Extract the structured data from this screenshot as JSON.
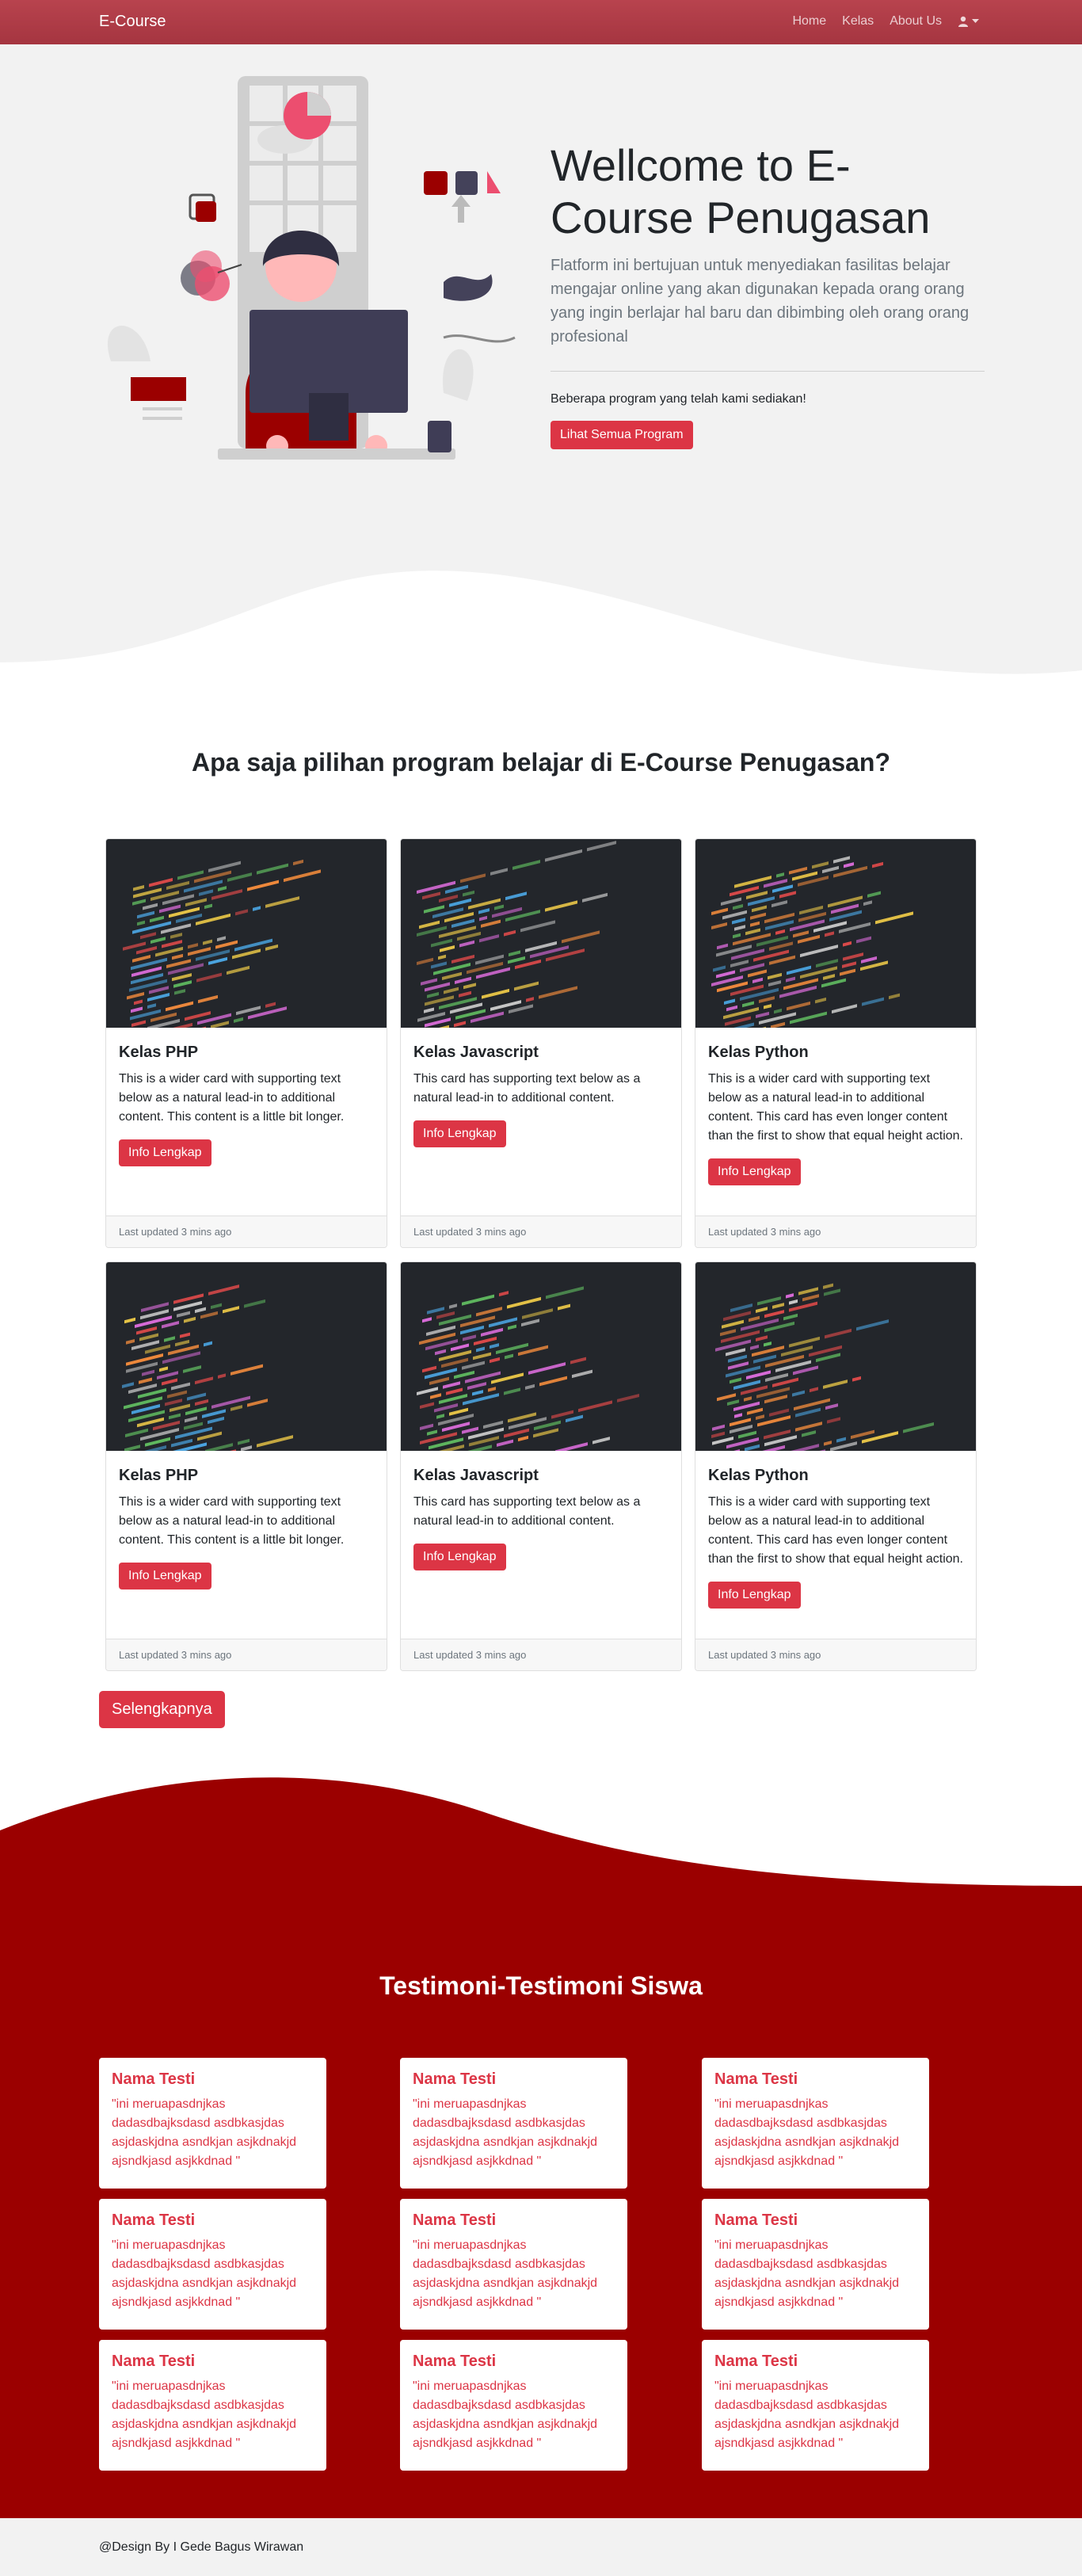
{
  "colors": {
    "brand_red": "#a53540",
    "accent_red": "#dc3545",
    "dark_red": "#9b0000",
    "hero_bg": "#f2f2f2"
  },
  "navbar": {
    "brand": "E-Course",
    "links": [
      "Home",
      "Kelas",
      "About Us"
    ],
    "user_icon": "user-icon"
  },
  "hero": {
    "title": "Wellcome to E-Course Penugasan",
    "lead": "Flatform ini bertujuan untuk menyediakan fasilitas belajar mengajar online yang akan digunakan kepada orang orang yang ingin berlajar hal baru dan dibimbing oleh orang orang profesional",
    "sub": "Beberapa program yang telah kami sediakan!",
    "button": "Lihat Semua Program"
  },
  "programs": {
    "title": "Apa saja pilihan program belajar di E-Course Penugasan?",
    "cards": [
      {
        "title": "Kelas PHP",
        "text": "This is a wider card with supporting text below as a natural lead-in to additional content. This content is a little bit longer.",
        "button": "Info Lengkap",
        "footer": "Last updated 3 mins ago"
      },
      {
        "title": "Kelas Javascript",
        "text": "This card has supporting text below as a natural lead-in to additional content.",
        "button": "Info Lengkap",
        "footer": "Last updated 3 mins ago"
      },
      {
        "title": "Kelas Python",
        "text": "This is a wider card with supporting text below as a natural lead-in to additional content. This card has even longer content than the first to show that equal height action.",
        "button": "Info Lengkap",
        "footer": "Last updated 3 mins ago"
      },
      {
        "title": "Kelas PHP",
        "text": "This is a wider card with supporting text below as a natural lead-in to additional content. This content is a little bit longer.",
        "button": "Info Lengkap",
        "footer": "Last updated 3 mins ago"
      },
      {
        "title": "Kelas Javascript",
        "text": "This card has supporting text below as a natural lead-in to additional content.",
        "button": "Info Lengkap",
        "footer": "Last updated 3 mins ago"
      },
      {
        "title": "Kelas Python",
        "text": "This is a wider card with supporting text below as a natural lead-in to additional content. This card has even longer content than the first to show that equal height action.",
        "button": "Info Lengkap",
        "footer": "Last updated 3 mins ago"
      }
    ],
    "more_button": "Selengkapnya"
  },
  "testimoni": {
    "title": "Testimoni-Testimoni Siswa",
    "items": [
      {
        "name": "Nama Testi",
        "text": "\"ini meruapasdnjkas dadasdbajksdasd asdbkasjdas asjdaskjdna asndkjan asjkdnakjd ajsndkjasd asjkkdnad \""
      },
      {
        "name": "Nama Testi",
        "text": "\"ini meruapasdnjkas dadasdbajksdasd asdbkasjdas asjdaskjdna asndkjan asjkdnakjd ajsndkjasd asjkkdnad \""
      },
      {
        "name": "Nama Testi",
        "text": "\"ini meruapasdnjkas dadasdbajksdasd asdbkasjdas asjdaskjdna asndkjan asjkdnakjd ajsndkjasd asjkkdnad \""
      },
      {
        "name": "Nama Testi",
        "text": "\"ini meruapasdnjkas dadasdbajksdasd asdbkasjdas asjdaskjdna asndkjan asjkdnakjd ajsndkjasd asjkkdnad \""
      },
      {
        "name": "Nama Testi",
        "text": "\"ini meruapasdnjkas dadasdbajksdasd asdbkasjdas asjdaskjdna asndkjan asjkdnakjd ajsndkjasd asjkkdnad \""
      },
      {
        "name": "Nama Testi",
        "text": "\"ini meruapasdnjkas dadasdbajksdasd asdbkasjdas asjdaskjdna asndkjan asjkdnakjd ajsndkjasd asjkkdnad \""
      },
      {
        "name": "Nama Testi",
        "text": "\"ini meruapasdnjkas dadasdbajksdasd asdbkasjdas asjdaskjdna asndkjan asjkdnakjd ajsndkjasd asjkkdnad \""
      },
      {
        "name": "Nama Testi",
        "text": "\"ini meruapasdnjkas dadasdbajksdasd asdbkasjdas asjdaskjdna asndkjan asjkdnakjd ajsndkjasd asjkkdnad \""
      },
      {
        "name": "Nama Testi",
        "text": "\"ini meruapasdnjkas dadasdbajksdasd asdbkasjdas asjdaskjdna asndkjan asjkdnakjd ajsndkjasd asjkkdnad \""
      }
    ]
  },
  "footer": {
    "text": "@Design By I Gede Bagus Wirawan"
  }
}
